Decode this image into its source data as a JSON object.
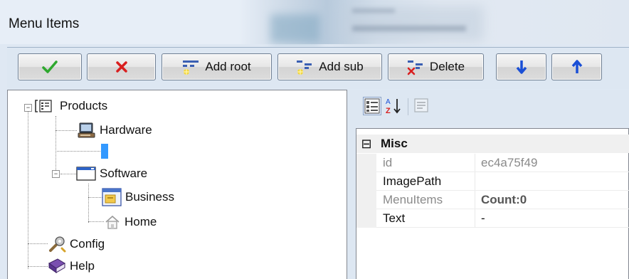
{
  "window": {
    "title": "Menu Items"
  },
  "toolbar": {
    "add_root_label": "Add root",
    "add_sub_label": "Add sub",
    "delete_label": "Delete"
  },
  "tree": {
    "products": "Products",
    "hardware": "Hardware",
    "selected_item": "",
    "software": "Software",
    "business": "Business",
    "home": "Home",
    "config": "Config",
    "help": "Help"
  },
  "properties": {
    "category": "Misc",
    "category_toggle": "⊟",
    "rows": [
      {
        "name": "id",
        "value": "ec4a75f49"
      },
      {
        "name": "ImagePath",
        "value": ""
      },
      {
        "name": "MenuItems",
        "value": "Count:0"
      },
      {
        "name": "Text",
        "value": "-"
      }
    ]
  },
  "colors": {
    "selection": "#3399ff",
    "accept": "#2ea82e",
    "cancel": "#d91f1f",
    "arrow": "#1a4fd6",
    "disabled_text": "#8a8a8a"
  }
}
